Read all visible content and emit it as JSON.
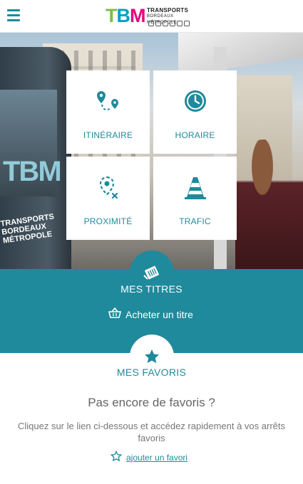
{
  "header": {
    "logo": {
      "mark": "TBM",
      "line1": "TRANSPORTS",
      "line2": "BORDEAUX MÉTROPOLE"
    },
    "menu_icon": "menu-icon"
  },
  "tiles": [
    {
      "label": "ITINÉRAIRE",
      "icon": "route-pin-icon"
    },
    {
      "label": "HORAIRE",
      "icon": "clock-icon"
    },
    {
      "label": "PROXIMITÉ",
      "icon": "nearby-pin-icon"
    },
    {
      "label": "TRAFIC",
      "icon": "traffic-cone-icon"
    }
  ],
  "titres": {
    "title": "MES TITRES",
    "buy_label": "Acheter un titre",
    "icon": "tickets-icon"
  },
  "favoris": {
    "title": "MES FAVORIS",
    "empty_title": "Pas encore de favoris ?",
    "empty_desc": "Cliquez sur le lien ci-dessous et accédez rapidement à vos arrêts favoris",
    "add_label": "ajouter un favori",
    "icon": "star-icon"
  },
  "colors": {
    "accent": "#1f8a9c",
    "background": "#ffffff"
  }
}
